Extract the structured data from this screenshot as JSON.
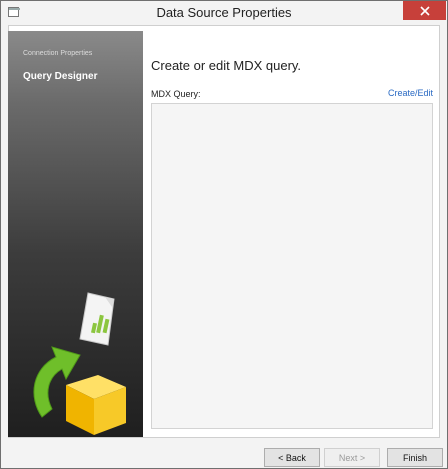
{
  "window": {
    "title": "Data Source Properties"
  },
  "sidebar": {
    "items": [
      {
        "label": "Connection Properties",
        "active": false
      },
      {
        "label": "Query Designer",
        "active": true
      }
    ]
  },
  "main": {
    "heading": "Create or edit MDX query.",
    "mdx_label": "MDX Query:",
    "create_edit_link": "Create/Edit",
    "query_value": ""
  },
  "footer": {
    "back_label": "< Back",
    "next_label": "Next >",
    "finish_label": "Finish"
  },
  "colors": {
    "close_button": "#c7403a",
    "link": "#2a6ac3",
    "sidebar_dark": "#1f1f1f"
  }
}
